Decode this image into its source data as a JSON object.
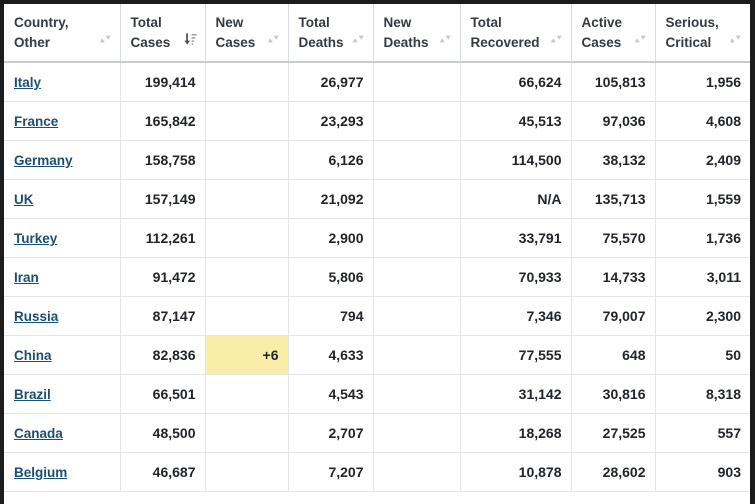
{
  "table": {
    "name": "coronavirus-country-statistics-table",
    "sort": {
      "active_column": "Total Cases",
      "direction": "desc"
    },
    "columns": [
      {
        "key": "country",
        "label_line1": "Country,",
        "label_line2": "Other",
        "sortable": true,
        "sort_state": "none",
        "icon": "sort-neutral-icon"
      },
      {
        "key": "total_cases",
        "label_line1": "Total",
        "label_line2": "Cases",
        "sortable": true,
        "sort_state": "desc",
        "icon": "sort-amount-desc-icon"
      },
      {
        "key": "new_cases",
        "label_line1": "New",
        "label_line2": "Cases",
        "sortable": true,
        "sort_state": "none",
        "icon": "sort-neutral-icon"
      },
      {
        "key": "total_deaths",
        "label_line1": "Total",
        "label_line2": "Deaths",
        "sortable": true,
        "sort_state": "none",
        "icon": "sort-neutral-icon"
      },
      {
        "key": "new_deaths",
        "label_line1": "New",
        "label_line2": "Deaths",
        "sortable": true,
        "sort_state": "none",
        "icon": "sort-neutral-icon"
      },
      {
        "key": "total_recovered",
        "label_line1": "Total",
        "label_line2": "Recovered",
        "sortable": true,
        "sort_state": "none",
        "icon": "sort-neutral-icon"
      },
      {
        "key": "active_cases",
        "label_line1": "Active",
        "label_line2": "Cases",
        "sortable": true,
        "sort_state": "none",
        "icon": "sort-neutral-icon"
      },
      {
        "key": "serious",
        "label_line1": "Serious,",
        "label_line2": "Critical",
        "sortable": true,
        "sort_state": "none",
        "icon": "sort-neutral-icon"
      }
    ],
    "rows": [
      {
        "country": "Italy",
        "total_cases": "199,414",
        "new_cases": "",
        "total_deaths": "26,977",
        "new_deaths": "",
        "total_recovered": "66,624",
        "active_cases": "105,813",
        "serious": "1,956",
        "new_cases_highlight": false
      },
      {
        "country": "France",
        "total_cases": "165,842",
        "new_cases": "",
        "total_deaths": "23,293",
        "new_deaths": "",
        "total_recovered": "45,513",
        "active_cases": "97,036",
        "serious": "4,608",
        "new_cases_highlight": false
      },
      {
        "country": "Germany",
        "total_cases": "158,758",
        "new_cases": "",
        "total_deaths": "6,126",
        "new_deaths": "",
        "total_recovered": "114,500",
        "active_cases": "38,132",
        "serious": "2,409",
        "new_cases_highlight": false
      },
      {
        "country": "UK",
        "total_cases": "157,149",
        "new_cases": "",
        "total_deaths": "21,092",
        "new_deaths": "",
        "total_recovered": "N/A",
        "active_cases": "135,713",
        "serious": "1,559",
        "new_cases_highlight": false
      },
      {
        "country": "Turkey",
        "total_cases": "112,261",
        "new_cases": "",
        "total_deaths": "2,900",
        "new_deaths": "",
        "total_recovered": "33,791",
        "active_cases": "75,570",
        "serious": "1,736",
        "new_cases_highlight": false
      },
      {
        "country": "Iran",
        "total_cases": "91,472",
        "new_cases": "",
        "total_deaths": "5,806",
        "new_deaths": "",
        "total_recovered": "70,933",
        "active_cases": "14,733",
        "serious": "3,011",
        "new_cases_highlight": false
      },
      {
        "country": "Russia",
        "total_cases": "87,147",
        "new_cases": "",
        "total_deaths": "794",
        "new_deaths": "",
        "total_recovered": "7,346",
        "active_cases": "79,007",
        "serious": "2,300",
        "new_cases_highlight": false
      },
      {
        "country": "China",
        "total_cases": "82,836",
        "new_cases": "+6",
        "total_deaths": "4,633",
        "new_deaths": "",
        "total_recovered": "77,555",
        "active_cases": "648",
        "serious": "50",
        "new_cases_highlight": true
      },
      {
        "country": "Brazil",
        "total_cases": "66,501",
        "new_cases": "",
        "total_deaths": "4,543",
        "new_deaths": "",
        "total_recovered": "31,142",
        "active_cases": "30,816",
        "serious": "8,318",
        "new_cases_highlight": false
      },
      {
        "country": "Canada",
        "total_cases": "48,500",
        "new_cases": "",
        "total_deaths": "2,707",
        "new_deaths": "",
        "total_recovered": "18,268",
        "active_cases": "27,525",
        "serious": "557",
        "new_cases_highlight": false
      },
      {
        "country": "Belgium",
        "total_cases": "46,687",
        "new_cases": "",
        "total_deaths": "7,207",
        "new_deaths": "",
        "total_recovered": "10,878",
        "active_cases": "28,602",
        "serious": "903",
        "new_cases_highlight": false
      }
    ]
  },
  "colors": {
    "highlight_new_cases": "#faeda7",
    "link": "#1b4f72",
    "header_text": "#343a40",
    "cell_text": "#212529",
    "grid_line": "#e3e6e9",
    "header_rule": "#c8cdd2",
    "frame": "#1c1c1c"
  }
}
